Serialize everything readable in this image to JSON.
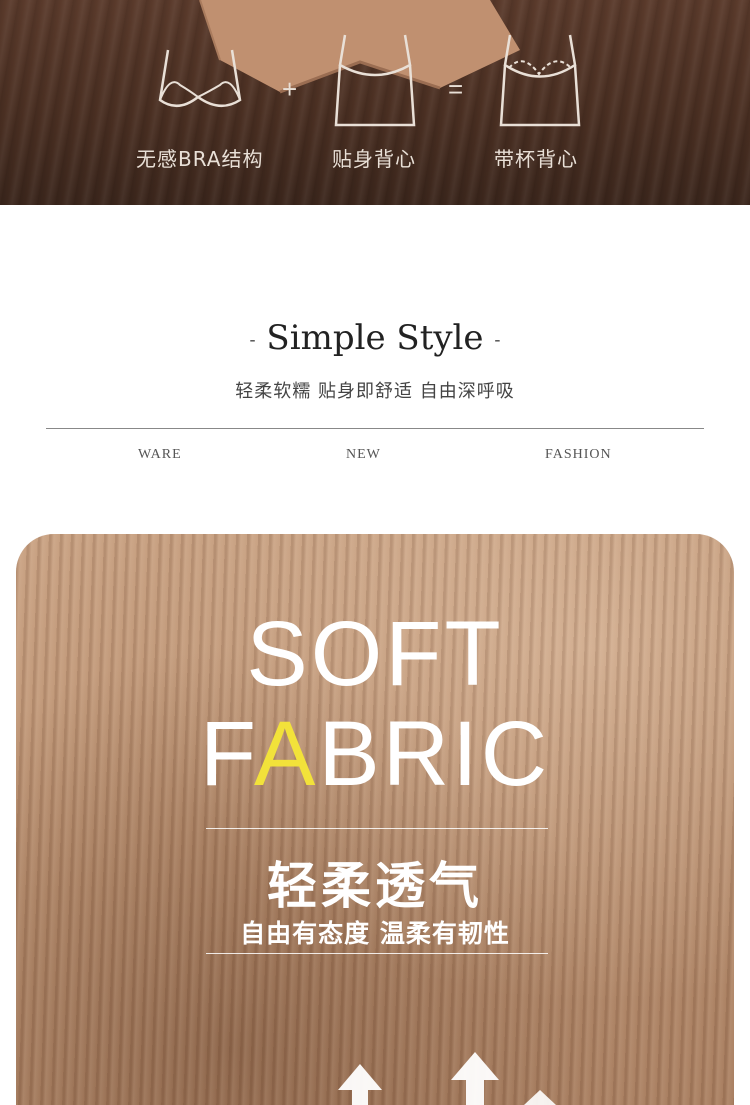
{
  "banner": {
    "captions": [
      "无感BRA结构",
      "贴身背心",
      "带杯背心"
    ],
    "plus": "+",
    "equals": "="
  },
  "style_section": {
    "title": "Simple Style",
    "title_dash_left": "-",
    "title_dash_right": "-",
    "subtitle": "轻柔软糯 贴身即舒适 自由深呼吸",
    "words": [
      "WARE",
      "NEW",
      "FASHION"
    ]
  },
  "fabric_section": {
    "line1": "SOFT",
    "line2_start": "F",
    "line2_highlight": "A",
    "line2_end": "BRIC",
    "headline_cn": "轻柔透气",
    "sub_cn": "自由有态度 温柔有韧性",
    "highlight_color": "#f2e23a"
  }
}
